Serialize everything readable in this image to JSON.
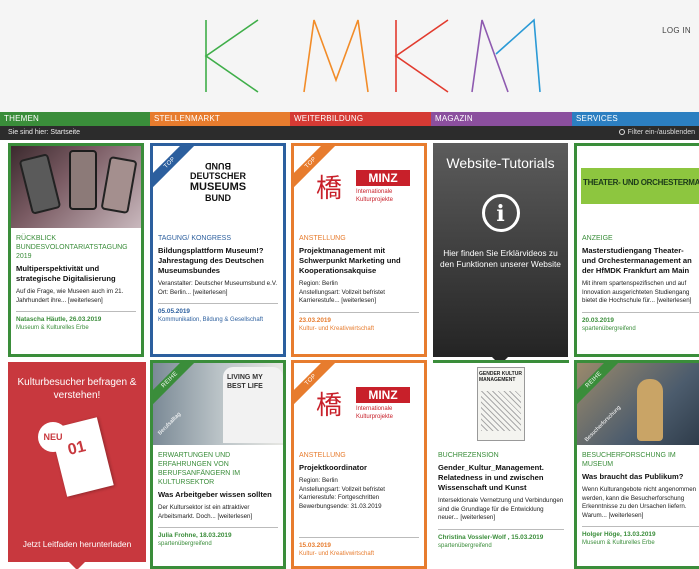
{
  "header": {
    "login": "LOG IN",
    "logo_colors": [
      "#3fae49",
      "#f28c28",
      "#e23b2e",
      "#8e5ab0",
      "#2b9ad6"
    ]
  },
  "nav": {
    "items": [
      {
        "label": "THEMEN",
        "color": "#3a8d3a"
      },
      {
        "label": "STELLENMARKT",
        "color": "#e77c2e"
      },
      {
        "label": "WEITERBILDUNG",
        "color": "#d53a34"
      },
      {
        "label": "MAGAZIN",
        "color": "#8b4f9e"
      },
      {
        "label": "SERVICES",
        "color": "#2c7fc1"
      }
    ]
  },
  "breadcrumb": {
    "text": "Sie sind hier: Startseite"
  },
  "filter": {
    "label": "Filter ein-/ausblenden"
  },
  "cards": [
    {
      "kicker": "RÜCKBLICK BUNDESVOLONTARIATSTAGUNG 2019",
      "title": "Multiperspektivität und strategische Digitalisierung",
      "text": "Auf die Frage, wie Museen auch im 21. Jahrhundert ihre... [weiterlesen]",
      "meta": "Natascha Häutle, 26.03.2019",
      "cat": "Museum & Kulturelles Erbe",
      "color": "#3a8d3a"
    },
    {
      "ribbon": "TOP",
      "logo_line1": "BUND",
      "logo_line2": "DEUTSCHER",
      "logo_line3": "MUSEUMS",
      "logo_line4": "BUND",
      "kicker": "TAGUNG/ KONGRESS",
      "title": "Bildungsplattform Museum!? Jahrestagung des Deutschen Museumsbundes",
      "text": "Veranstalter: Deutscher Museumsbund e.V.",
      "text2": "Ort: Berlin... [weiterlesen]",
      "meta": "05.05.2019",
      "cat": "Kommunikation, Bildung & Gesellschaft",
      "color": "#2c5f9e"
    },
    {
      "ribbon": "TOP",
      "logo_name": "MINZ",
      "logo_sub": "Internationale Kulturprojekte",
      "kicker": "ANSTELLUNG",
      "title": "Projektmanagement mit Schwerpunkt Marketing und Kooperationsakquise",
      "text": "Region: Berlin",
      "text2": "Anstellungsart: Vollzeit befristet",
      "text3": "Karrierestufe... [weiterlesen]",
      "meta": "23.03.2019",
      "cat": "Kultur- und Kreativwirtschaft",
      "color": "#e77c2e"
    },
    {
      "tutorial_title": "Website-Tutorials",
      "tutorial_text": "Hier finden Sie Erklärvideos zu den Funktionen unserer Website"
    },
    {
      "banner": "THEATER- UND ORCHESTERMANAGEMENT",
      "kicker": "ANZEIGE",
      "title": "Masterstudiengang Theater- und Orchestermanagement an der HfMDK Frankfurt am Main",
      "text": "Mit ihrem spartenspezifischen und auf Innovation ausgerichteten Studiengang bietet die Hochschule für... [weiterlesen]",
      "meta": "20.03.2019",
      "cat": "spartenübergreifend",
      "color": "#3a8d3a"
    },
    {
      "tile_title": "Kulturbesucher befragen & verstehen!",
      "badge": "NEU",
      "num": "01",
      "tile_cta": "Jetzt Leitfaden herunterladen"
    },
    {
      "ribbon": "REIHE",
      "ribbon2": "Berufsalltag",
      "shirt": "LIVING MY BEST LIFE",
      "kicker": "ERWARTUNGEN UND ERFAHRUNGEN VON BERUFSANFÄNGERN IM KULTURSEKTOR",
      "title": "Was Arbeitgeber wissen sollten",
      "text": "Der Kultursektor ist ein attraktiver Arbeitsmarkt. Doch... [weiterlesen]",
      "meta": "Julia Frohne, 18.03.2019",
      "cat": "spartenübergreifend",
      "color": "#3a8d3a"
    },
    {
      "ribbon": "TOP",
      "logo_name": "MINZ",
      "logo_sub": "Internationale Kulturprojekte",
      "kicker": "ANSTELLUNG",
      "title": "Projektkoordinator",
      "text": "Region: Berlin",
      "text2": "Anstellungsart: Vollzeit befristet",
      "text3": "Karrierestufe: Fortgeschritten",
      "text4": "Bewerbungsende: 31.03.2019",
      "meta": "15.03.2019",
      "cat": "Kultur- und Kreativwirtschaft",
      "color": "#e77c2e"
    },
    {
      "book": "GENDER KULTUR MANAGEMENT",
      "kicker": "BUCHREZENSION",
      "title": "Gender_Kultur_Management. Relatedness in und zwischen Wissenschaft und Kunst",
      "text": "Intersektionale Vernetzung und Verbindungen sind die Grundlage für die Entwicklung neuer... [weiterlesen]",
      "meta": "Christina Vossler-Wolf , 15.03.2019",
      "cat": "spartenübergreifend",
      "color": "#3a8d3a"
    },
    {
      "ribbon": "REIHE",
      "ribbon2": "Besucherforschung",
      "kicker": "BESUCHERFORSCHUNG IM MUSEUM",
      "title": "Was braucht das Publikum?",
      "text": "Wenn Kulturangebote nicht angenommen werden, kann die Besucherforschung Erkenntnisse zu den Ursachen liefern. Warum... [weiterlesen]",
      "meta": "Holger Höge, 13.03.2019",
      "cat": "Museum & Kulturelles Erbe",
      "color": "#3a8d3a"
    }
  ]
}
